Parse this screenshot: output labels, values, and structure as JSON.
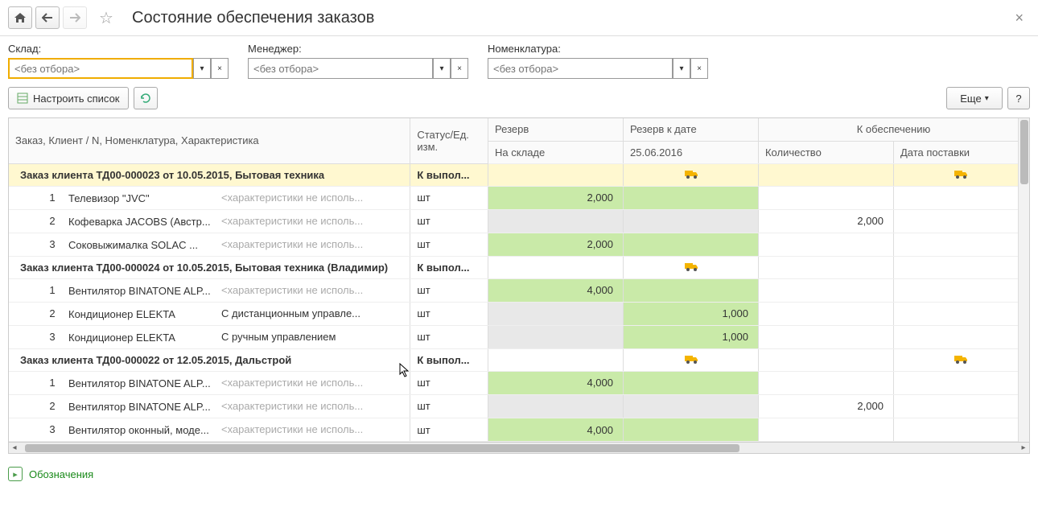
{
  "header": {
    "title": "Состояние обеспечения заказов"
  },
  "filters": {
    "warehouse": {
      "label": "Склад:",
      "placeholder": "<без отбора>"
    },
    "manager": {
      "label": "Менеджер:",
      "placeholder": "<без отбора>"
    },
    "nomen": {
      "label": "Номенклатура:",
      "placeholder": "<без отбора>"
    }
  },
  "toolbar": {
    "configure": "Настроить список",
    "more": "Еще",
    "help": "?"
  },
  "table": {
    "headers": {
      "nomen": "Заказ, Клиент / N, Номенклатура, Характеристика",
      "status": "Статус/Ед. изм.",
      "reserve": "Резерв",
      "reserve_sub": "На складе",
      "bydate": "Резерв к дате",
      "bydate_sub": "25.06.2016",
      "provision": "К обеспечению",
      "qty_sub": "Количество",
      "ship_sub": "Дата поставки"
    },
    "groups": [
      {
        "title": "Заказ клиента ТД00-000023 от 10.05.2015, Бытовая техника",
        "status": "К выпол...",
        "highlight": true,
        "truck_bydate": true,
        "truck_ship": true,
        "rows": [
          {
            "n": "1",
            "name": "Телевизор \"JVC\"",
            "char": "<характеристики не исполь...",
            "unit": "шт",
            "reserve": "2,000",
            "bydate": "",
            "qty": "",
            "reserve_green": true,
            "bydate_green": true
          },
          {
            "n": "2",
            "name": "Кофеварка JACOBS (Австр...",
            "char": "<характеристики не исполь...",
            "unit": "шт",
            "reserve": "",
            "bydate": "",
            "qty": "2,000",
            "reserve_grey": true,
            "bydate_grey": true
          },
          {
            "n": "3",
            "name": "Соковыжималка  SOLAC ...",
            "char": "<характеристики не исполь...",
            "unit": "шт",
            "reserve": "2,000",
            "bydate": "",
            "qty": "",
            "reserve_green": true,
            "bydate_green": true
          }
        ]
      },
      {
        "title": "Заказ клиента ТД00-000024 от 10.05.2015, Бытовая техника (Владимир)",
        "status": "К выпол...",
        "highlight": false,
        "truck_bydate": true,
        "truck_ship": false,
        "rows": [
          {
            "n": "1",
            "name": "Вентилятор BINATONE ALP...",
            "char": "<характеристики не исполь...",
            "unit": "шт",
            "reserve": "4,000",
            "bydate": "",
            "qty": "",
            "reserve_green": true,
            "bydate_green": true
          },
          {
            "n": "2",
            "name": "Кондиционер ELEKTA",
            "char": "С дистанционным управле...",
            "unit": "шт",
            "reserve": "",
            "bydate": "1,000",
            "qty": "",
            "reserve_grey": true,
            "bydate_green": true
          },
          {
            "n": "3",
            "name": "Кондиционер ELEKTA",
            "char": "С ручным управлением",
            "unit": "шт",
            "reserve": "",
            "bydate": "1,000",
            "qty": "",
            "reserve_grey": true,
            "bydate_green": true
          }
        ]
      },
      {
        "title": "Заказ клиента ТД00-000022 от 12.05.2015, Дальстрой",
        "status": "К выпол...",
        "highlight": false,
        "truck_bydate": true,
        "truck_ship": true,
        "rows": [
          {
            "n": "1",
            "name": "Вентилятор BINATONE ALP...",
            "char": "<характеристики не исполь...",
            "unit": "шт",
            "reserve": "4,000",
            "bydate": "",
            "qty": "",
            "reserve_green": true,
            "bydate_green": true
          },
          {
            "n": "2",
            "name": "Вентилятор BINATONE ALP...",
            "char": "<характеристики не исполь...",
            "unit": "шт",
            "reserve": "",
            "bydate": "",
            "qty": "2,000",
            "reserve_grey": true,
            "bydate_grey": true
          },
          {
            "n": "3",
            "name": "Вентилятор оконный, моде...",
            "char": "<характеристики не исполь...",
            "unit": "шт",
            "reserve": "4,000",
            "bydate": "",
            "qty": "",
            "reserve_green": true,
            "bydate_green": true
          }
        ]
      }
    ]
  },
  "footer": {
    "legend": "Обозначения"
  }
}
